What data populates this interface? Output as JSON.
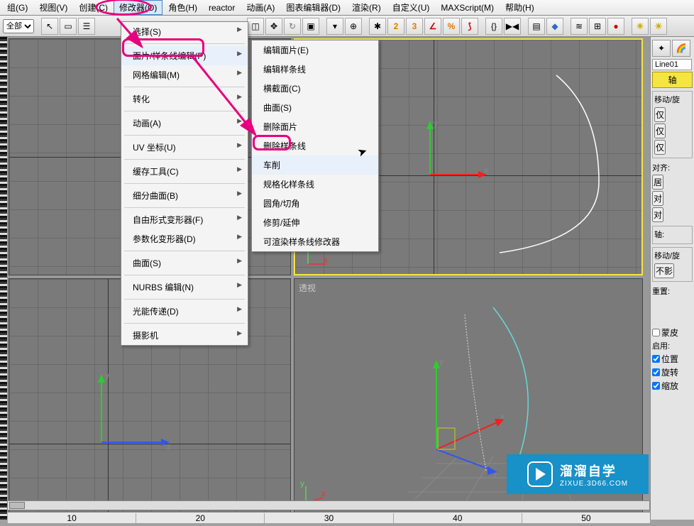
{
  "menubar": {
    "items": [
      {
        "label": "组(G)"
      },
      {
        "label": "视图(V)"
      },
      {
        "label": "创建(C)"
      },
      {
        "label": "修改器(O)"
      },
      {
        "label": "角色(H)"
      },
      {
        "label": "reactor"
      },
      {
        "label": "动画(A)"
      },
      {
        "label": "图表编辑器(D)"
      },
      {
        "label": "渲染(R)"
      },
      {
        "label": "自定义(U)"
      },
      {
        "label": "MAXScript(M)"
      },
      {
        "label": "帮助(H)"
      }
    ],
    "active_index": 3
  },
  "toolbar": {
    "filter_label": "全部"
  },
  "dropdown1": {
    "items": [
      {
        "label": "选择(S)",
        "sub": true
      },
      {
        "label": "面片/样条线编辑(P)",
        "sub": true,
        "hover": true
      },
      {
        "label": "网格编辑(M)",
        "sub": true
      },
      {
        "label": "转化",
        "sub": true
      },
      {
        "label": "动画(A)",
        "sub": true
      },
      {
        "label": "UV 坐标(U)",
        "sub": true
      },
      {
        "label": "缓存工具(C)",
        "sub": true
      },
      {
        "label": "细分曲面(B)",
        "sub": true
      },
      {
        "label": "自由形式变形器(F)",
        "sub": true
      },
      {
        "label": "参数化变形器(D)",
        "sub": true
      },
      {
        "label": "曲面(S)",
        "sub": true
      },
      {
        "label": "NURBS 编辑(N)",
        "sub": true
      },
      {
        "label": "光能传递(D)",
        "sub": true
      },
      {
        "label": "摄影机",
        "sub": true
      }
    ]
  },
  "dropdown2": {
    "items": [
      {
        "label": "编辑面片(E)"
      },
      {
        "label": "编辑样条线"
      },
      {
        "label": "横截面(C)"
      },
      {
        "label": "曲面(S)"
      },
      {
        "label": "删除面片"
      },
      {
        "label": "删除样条线"
      },
      {
        "label": "车削",
        "hover": true
      },
      {
        "label": "规格化样条线"
      },
      {
        "label": "圆角/切角"
      },
      {
        "label": "修剪/延伸"
      },
      {
        "label": "可渲染样条线修改器"
      }
    ]
  },
  "viewports": {
    "br_label": "透视"
  },
  "right_panel": {
    "object_name": "Line01",
    "axis_btn": "轴",
    "sec1": "移动/旋",
    "btn_only": "仅",
    "btn_only2": "仅",
    "btn_only3": "仅",
    "align": "对齐:",
    "align_center": "居",
    "align_to": "对",
    "align_to2": "对",
    "axis_label": "轴:",
    "sec2": "移动/旋",
    "no": "不影",
    "reset": "重置:",
    "skin": "蒙皮",
    "enable": "启用:",
    "chk_pos": "位置",
    "chk_rot": "旋转",
    "chk_scl": "缩放"
  },
  "logo": {
    "cn": "溜溜自学",
    "en": "ZIXUE.3D66.COM"
  },
  "ruler": {
    "ticks": [
      "10",
      "20",
      "30",
      "40",
      "50"
    ]
  }
}
